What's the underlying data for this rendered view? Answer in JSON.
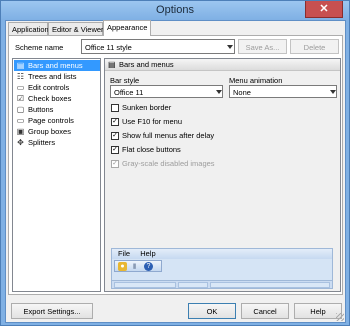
{
  "window": {
    "title": "Options",
    "close_glyph": "✕"
  },
  "tabs": [
    {
      "label": "Application",
      "active": false
    },
    {
      "label": "Editor & Viewers",
      "active": false
    },
    {
      "label": "Appearance",
      "active": true
    }
  ],
  "scheme": {
    "label": "Scheme name",
    "value": "Office 11 style",
    "save_as_label": "Save As...",
    "delete_label": "Delete"
  },
  "categories": [
    {
      "label": "Bars and menus",
      "icon": "bars-menus-icon",
      "glyph": "▤",
      "selected": true
    },
    {
      "label": "Trees and lists",
      "icon": "tree-list-icon",
      "glyph": "☷",
      "selected": false
    },
    {
      "label": "Edit controls",
      "icon": "edit-control-icon",
      "glyph": "▭",
      "selected": false
    },
    {
      "label": "Check boxes",
      "icon": "check-box-icon",
      "glyph": "☑",
      "selected": false
    },
    {
      "label": "Buttons",
      "icon": "button-icon",
      "glyph": "▢",
      "selected": false
    },
    {
      "label": "Page controls",
      "icon": "page-control-icon",
      "glyph": "▭",
      "selected": false
    },
    {
      "label": "Group boxes",
      "icon": "group-box-icon",
      "glyph": "▣",
      "selected": false
    },
    {
      "label": "Splitters",
      "icon": "splitter-icon",
      "glyph": "✥",
      "selected": false
    }
  ],
  "pane": {
    "header": "Bars and menus",
    "header_icon": "bars-menus-icon",
    "bar_style_label": "Bar style",
    "bar_style_value": "Office 11",
    "menu_animation_label": "Menu animation",
    "menu_animation_value": "None",
    "options": [
      {
        "label": "Sunken border",
        "checked": false,
        "enabled": true
      },
      {
        "label": "Use F10 for menu",
        "checked": true,
        "enabled": true
      },
      {
        "label": "Show full menus after delay",
        "checked": true,
        "enabled": true
      },
      {
        "label": "Flat close buttons",
        "checked": true,
        "enabled": true
      },
      {
        "label": "Gray-scale disabled images",
        "checked": true,
        "enabled": false
      }
    ],
    "check_glyph": "✓",
    "preview": {
      "menu_file": "File",
      "menu_help": "Help"
    }
  },
  "buttons": {
    "export": "Export Settings...",
    "ok": "OK",
    "cancel": "Cancel",
    "help": "Help"
  },
  "colors": {
    "frame": "#7fb0e4",
    "selection": "#3399ff",
    "preview_bg": "#d5e4f5"
  }
}
